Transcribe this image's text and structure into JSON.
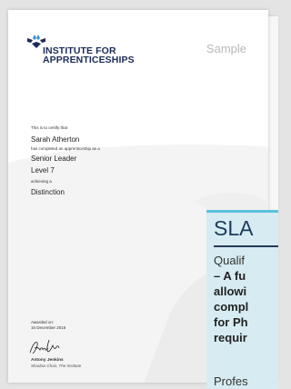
{
  "certificate": {
    "org_name_line1": "INSTITUTE FOR",
    "org_name_line2": "APPRENTICESHIPS",
    "watermark": "Sample",
    "certify_text": "This is to certify that",
    "recipient": "Sarah Atherton",
    "completed_text": "has completed an apprenticeship as a",
    "role": "Senior Leader",
    "level": "Level 7",
    "achieving_text": "achieving a",
    "grade": "Distinction",
    "awarded_label": "Awarded on:",
    "awarded_date": "16 December 2016",
    "signatory_name": "Antony Jenkins",
    "signatory_role": "Shadow Chair, The Institute",
    "brand_color": "#1c2b58",
    "accent_color": "#3a8fd0"
  },
  "overlay": {
    "title": "SLA",
    "line1": "Qualif",
    "line2": "– A fu",
    "line3": "allowi",
    "line4": "compl",
    "line5": "for Ph",
    "line6": "requir",
    "line7": "Profes",
    "accent_color": "#5bc1df"
  }
}
